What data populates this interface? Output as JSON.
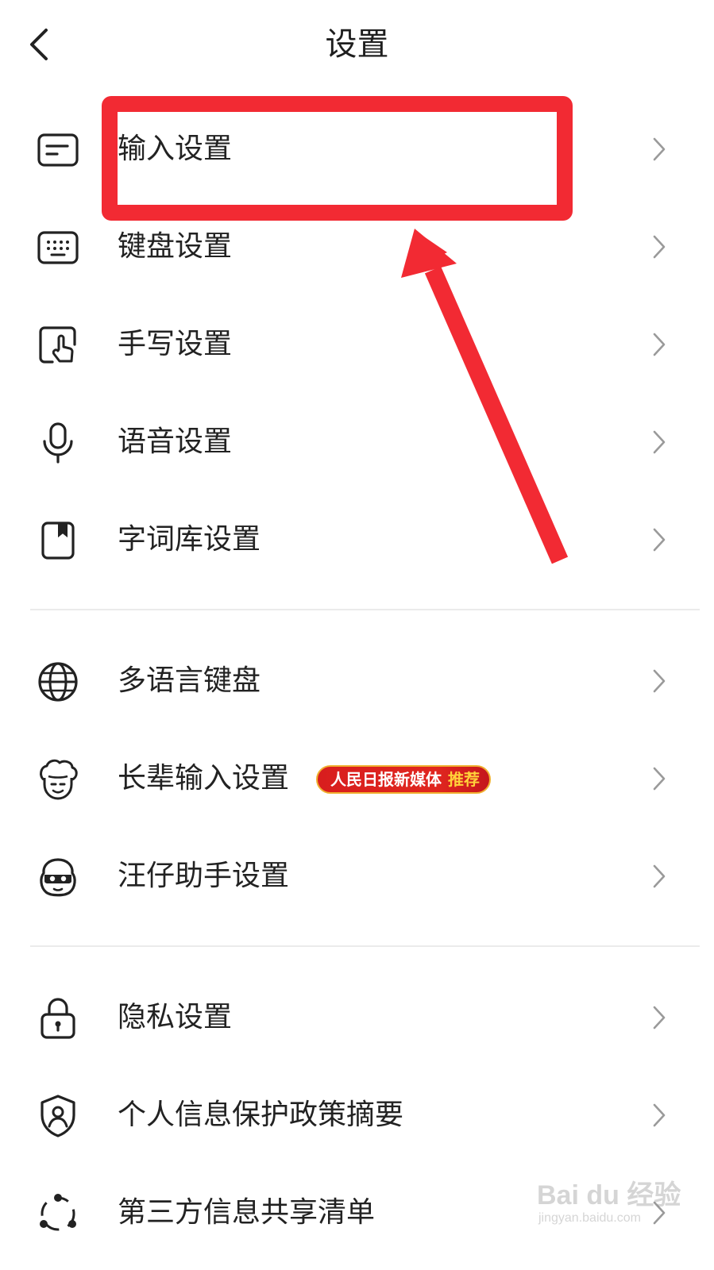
{
  "header": {
    "title": "设置",
    "back_icon": "chevron-left-icon"
  },
  "group1": [
    {
      "label": "输入设置",
      "icon": "input-card-icon"
    },
    {
      "label": "键盘设置",
      "icon": "keyboard-icon"
    },
    {
      "label": "手写设置",
      "icon": "handwriting-icon"
    },
    {
      "label": "语音设置",
      "icon": "microphone-icon"
    },
    {
      "label": "字词库设置",
      "icon": "dictionary-icon"
    }
  ],
  "group2": [
    {
      "label": "多语言键盘",
      "icon": "globe-icon"
    },
    {
      "label": "长辈输入设置",
      "icon": "elder-face-icon",
      "badge": {
        "main": "人民日报新媒体",
        "highlight": "推荐"
      }
    },
    {
      "label": "汪仔助手设置",
      "icon": "dog-assistant-icon"
    }
  ],
  "group3": [
    {
      "label": "隐私设置",
      "icon": "lock-icon"
    },
    {
      "label": "个人信息保护政策摘要",
      "icon": "shield-person-icon"
    },
    {
      "label": "第三方信息共享清单",
      "icon": "share-nodes-icon"
    }
  ],
  "annotation": {
    "highlight_color": "#f22a33",
    "highlighted_item": "输入设置"
  },
  "watermark": {
    "brand": "Bai du 经验",
    "url": "jingyan.baidu.com"
  },
  "colors": {
    "text": "#222222",
    "chevron": "#9a9a9a",
    "divider": "#ebebeb",
    "badge_bg": "#d81e1e",
    "badge_highlight": "#ffd23a"
  }
}
